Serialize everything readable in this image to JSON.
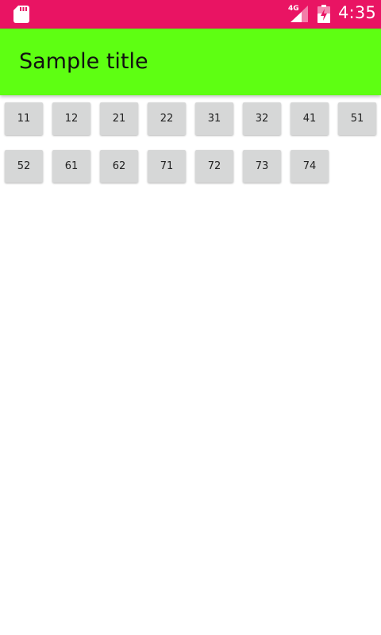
{
  "status_bar": {
    "color": "#E91463",
    "sd_icon": "sd-card-icon",
    "network_type": "4G",
    "signal_icon": "cell-signal-icon",
    "battery_icon": "battery-charging-icon",
    "time": "4:35"
  },
  "app_bar": {
    "color": "#5EFF12",
    "title": "Sample title"
  },
  "buttons": [
    "11",
    "12",
    "21",
    "22",
    "31",
    "32",
    "41",
    "51",
    "52",
    "61",
    "62",
    "71",
    "72",
    "73",
    "74"
  ]
}
